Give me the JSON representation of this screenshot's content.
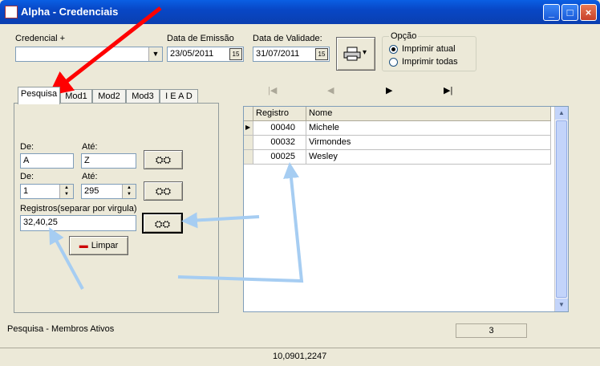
{
  "window": {
    "title": "Alpha - Credenciais",
    "minimize": "_",
    "maximize": "□",
    "close": "×"
  },
  "credencial": {
    "label": "Credencial +",
    "value": ""
  },
  "emissao": {
    "label": "Data de Emissão",
    "value": "23/05/2011",
    "cal": "15"
  },
  "validade": {
    "label": "Data de Validade:",
    "value": "31/07/2011",
    "cal": "15"
  },
  "print_button": {
    "icon": "printer-icon",
    "arrow": "▾"
  },
  "opcao": {
    "label": "Opção",
    "options": [
      "Imprimir atual",
      "Imprimir todas"
    ],
    "selected": 0
  },
  "tabs": [
    "Pesquisa",
    "Mod1",
    "Mod2",
    "Mod3",
    "I E A D"
  ],
  "pesquisa": {
    "de1_label": "De:",
    "ate1_label": "Até:",
    "de1_value": "A",
    "ate1_value": "Z",
    "de2_label": "De:",
    "ate2_label": "Até:",
    "de2_value": "1",
    "ate2_value": "295",
    "registros_label": "Registros(separar por virgula)",
    "registros_value": "32,40,25",
    "limpar_label": "Limpar",
    "binoculars": "👓"
  },
  "nav": {
    "first": "|◀",
    "prev": "◀",
    "next": "▶",
    "last": "▶|"
  },
  "grid": {
    "columns": [
      "Registro",
      "Nome"
    ],
    "rows": [
      {
        "registro": "00040",
        "nome": "Michele"
      },
      {
        "registro": "00032",
        "nome": "Virmondes"
      },
      {
        "registro": "00025",
        "nome": "Wesley"
      }
    ]
  },
  "status": {
    "text": "Pesquisa - Membros Ativos",
    "count": "3",
    "footer": "10,0901,2247"
  },
  "colors": {
    "title_blue": "#0a5fe3",
    "arrow_red": "#ff0000",
    "arrow_blue": "#a6cdf2"
  }
}
